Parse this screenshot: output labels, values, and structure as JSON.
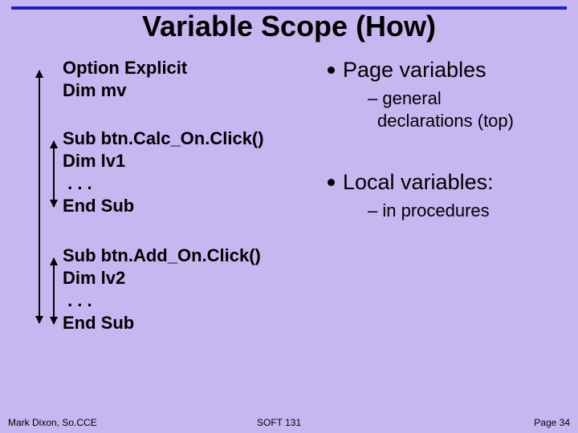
{
  "title": "Variable Scope (How)",
  "code": {
    "l1": "Option Explicit",
    "l2": "Dim mv",
    "l3": "Sub btn.Calc_On.Click()",
    "l4": "Dim lv1",
    "l5": " . . .",
    "l6": "End Sub",
    "l7": "Sub btn.Add_On.Click()",
    "l8": "Dim lv2",
    "l9": " . . .",
    "l10": "End Sub"
  },
  "bullets": {
    "b1": "Page variables",
    "b1s1a": "– general",
    "b1s1b": "declarations (top)",
    "b2": "Local variables:",
    "b2s1": "– in procedures"
  },
  "footer": {
    "left": "Mark Dixon, So.CCE",
    "center": "SOFT 131",
    "right": "Page 34"
  }
}
